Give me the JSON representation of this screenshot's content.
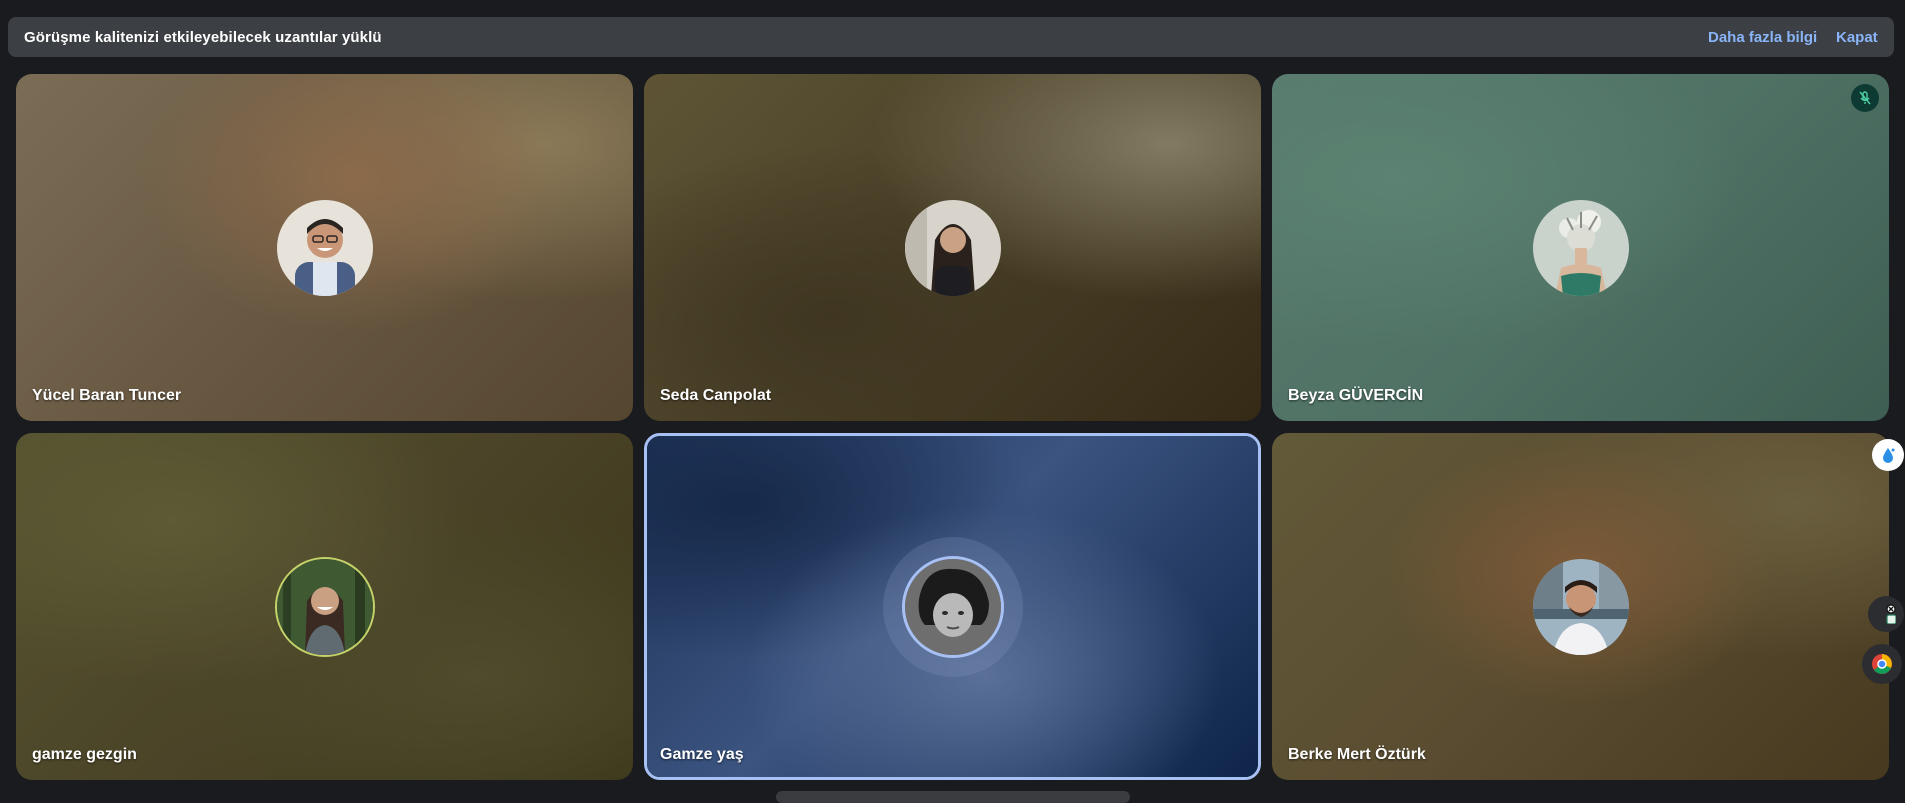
{
  "banner": {
    "message": "Görüşme kalitenizi etkileyebilecek uzantılar yüklü",
    "learn_more": "Daha fazla bilgi",
    "close": "Kapat"
  },
  "participants": [
    {
      "name": "Yücel Baran Tuncer",
      "muted": false,
      "speaking": false
    },
    {
      "name": "Seda Canpolat",
      "muted": false,
      "speaking": false
    },
    {
      "name": "Beyza GÜVERCİN",
      "muted": true,
      "speaking": false
    },
    {
      "name": "gamze gezgin",
      "muted": false,
      "speaking": false
    },
    {
      "name": "Gamze yaş",
      "muted": false,
      "speaking": true
    },
    {
      "name": "Berke Mert Öztürk",
      "muted": false,
      "speaking": false
    }
  ],
  "icons": {
    "mute": "mic-off-icon",
    "extension_1": "water-drop-icon",
    "extension_2": "close-circle-icon",
    "extension_3": "chrome-icon"
  },
  "colors": {
    "banner_bg": "#3c3f43",
    "link": "#8ab4f8",
    "active_border": "#a8c1f5",
    "page_bg": "#1a1b1e"
  }
}
